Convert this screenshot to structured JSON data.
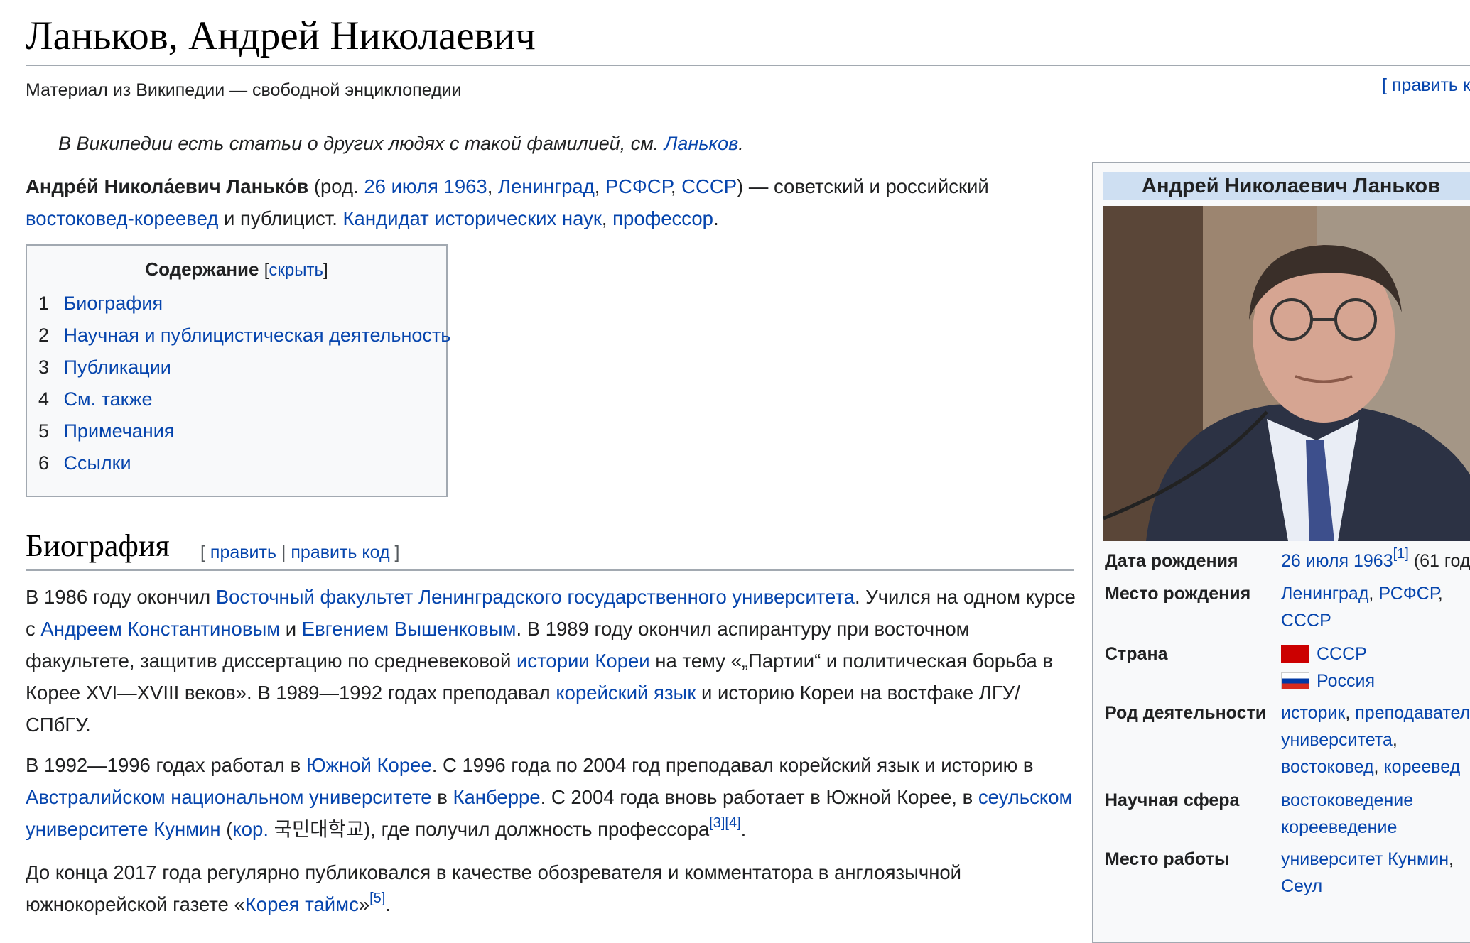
{
  "page": {
    "title": "Ланьков, Андрей Николаевич",
    "tagline": "Материал из Википедии — свободной энциклопедии",
    "top_edit": "[ править к",
    "hatnote_text": "В Википедии есть статьи о других людях с такой фамилией, см.",
    "hatnote_link": "Ланьков",
    "hatnote_end": "."
  },
  "lead": {
    "name": "Андре́й Никола́евич Ланько́в",
    "born_prefix": "(род.",
    "born_date": "26 июля 1963",
    "comma1": ",",
    "born_city": "Ленинград",
    "comma2": ",",
    "born_rsfsr": "РСФСР",
    "comma3": ",",
    "born_ussr": "СССР",
    "after_born": ") — советский и российский",
    "field_link": "востоковед-кореевед",
    "and_publicist": "и публицист.",
    "degree_link": "Кандидат исторических наук",
    "comma4": ",",
    "professor_link": "профессор",
    "end": "."
  },
  "toc": {
    "title": "Содержание",
    "hide_open": "[",
    "hide_label": "скрыть",
    "hide_close": "]",
    "items": [
      {
        "num": "1",
        "label": "Биография"
      },
      {
        "num": "2",
        "label": "Научная и публицистическая деятельность"
      },
      {
        "num": "3",
        "label": "Публикации"
      },
      {
        "num": "4",
        "label": "См. также"
      },
      {
        "num": "5",
        "label": "Примечания"
      },
      {
        "num": "6",
        "label": "Ссылки"
      }
    ]
  },
  "biography": {
    "heading": "Биография",
    "edit_open": "[",
    "edit_label": "править",
    "edit_sep": "|",
    "edit_code_label": "править код",
    "edit_close": "]",
    "p1": {
      "t1": "В 1986 году окончил",
      "l1": "Восточный факультет Ленинградского государственного университета",
      "t2": ". Учился на одном курсе с",
      "l2": "Андреем Константиновым",
      "t3": "и",
      "l3": "Евгением Вышенковым",
      "t4": ". В 1989 году окончил аспирантуру при восточном факультете, защитив диссертацию по средневековой",
      "l4": "истории Кореи",
      "t5": "на тему «„Партии“ и политическая борьба в Корее XVI—XVIII веков». В 1989—1992 годах преподавал",
      "l5": "корейский язык",
      "t6": "и историю Кореи на востфаке ЛГУ/СПбГУ."
    },
    "p2": {
      "t1": "В 1992—1996 годах работал в",
      "l1": "Южной Корее",
      "t2": ". С 1996 года по 2004 год преподавал корейский язык и историю в",
      "l2": "Австралийском национальном университете",
      "t3": "в",
      "l3": "Канберре",
      "t4": ". С 2004 года вновь работает в Южной Корее, в",
      "l4": "сеульском университете Кунмин",
      "t5": "(",
      "l5": "кор.",
      "t6": "국민대학교), где получил должность профессора",
      "ref1": "[3]",
      "ref2": "[4]",
      "t7": "."
    },
    "p3": {
      "t1": "До конца 2017 года регулярно публиковался в качестве обозревателя и комментатора в англоязычной южнокорейской газете «",
      "l1": "Корея таймс",
      "t2": "»",
      "ref1": "[5]",
      "t3": "."
    }
  },
  "infobox": {
    "title": "Андрей Николаевич Ланьков",
    "birth_date_label": "Дата рождения",
    "birth_date": "26 июля 1963",
    "birth_date_ref": "[1]",
    "birth_date_age": "(61 год",
    "birth_place_label": "Место рождения",
    "birth_place_1": "Ленинград",
    "birth_place_sep": ",",
    "birth_place_2": "РСФСР",
    "birth_place_3": "СССР",
    "country_label": "Страна",
    "country_1": "СССР",
    "country_2": "Россия",
    "occupation_label": "Род деятельности",
    "occ_1": "историк",
    "occ_2": "преподавател",
    "occ_3": "университета",
    "occ_4": "востоковед",
    "occ_5": "кореевед",
    "field_label": "Научная сфера",
    "field_1": "востоковедение",
    "field_2": "корееведение",
    "work_label": "Место работы",
    "work_1": "университет Кунмин",
    "work_2": "Сеул"
  },
  "colors": {
    "link": "#0645ad",
    "border": "#a2a9b1",
    "infobox_header": "#cedff2",
    "toc_bg": "#f8f9fa"
  }
}
